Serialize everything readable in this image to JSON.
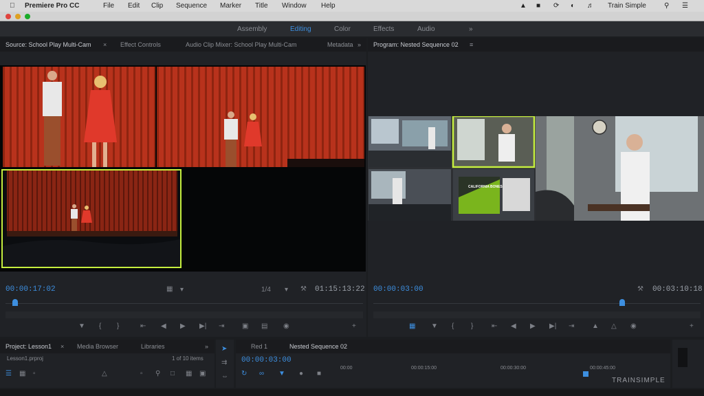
{
  "menubar": {
    "app_name": "Premiere Pro CC",
    "items": [
      "File",
      "Edit",
      "Clip",
      "Sequence",
      "Marker",
      "Title",
      "Window",
      "Help"
    ],
    "right_user": "Train Simple"
  },
  "workspaces": [
    "Assembly",
    "Editing",
    "Color",
    "Effects",
    "Audio"
  ],
  "source_panel": {
    "tabs": [
      "Source: School Play Multi-Cam",
      "Effect Controls",
      "Audio Clip Mixer: School Play Multi-Cam",
      "Metadata"
    ],
    "timecode_left": "00:00:17:02",
    "fit": "1/4",
    "timecode_right": "01:15:13:22"
  },
  "program_panel": {
    "tab": "Program: Nested Sequence 02",
    "timecode_left": "00:00:03:00",
    "timecode_right": "00:03:10:18",
    "slide_title": "CALIFORNIA BONES"
  },
  "project_panel": {
    "tabs": [
      "Project: Lesson1",
      "Media Browser",
      "Libraries"
    ],
    "search_placeholder": "Lesson1.prproj",
    "item_count": "1 of 10 items"
  },
  "timeline_panel": {
    "tabs": [
      "Red 1",
      "Nested Sequence 02"
    ],
    "timecode": "00:00:03:00",
    "ruler": [
      "00:00",
      "00:00:15:00",
      "00:00:30:00",
      "00:00:45:00"
    ]
  },
  "watermark": "TRAINSIMPLE",
  "colors": {
    "accent_blue": "#3d8fe0",
    "active_border": "#c6ef3f",
    "curtain_red": "#b8321c"
  }
}
